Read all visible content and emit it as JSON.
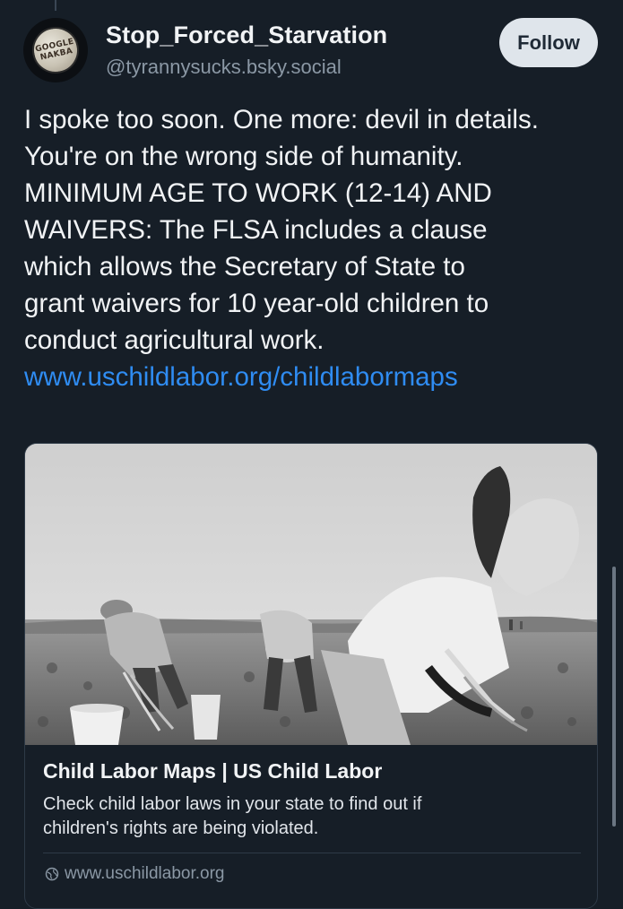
{
  "author": {
    "display_name": "Stop_Forced_Starvation",
    "handle": "@tyrannysucks.bsky.social",
    "avatar_text_line1": "GOOGLE",
    "avatar_text_line2": "NAKBA"
  },
  "actions": {
    "follow_label": "Follow"
  },
  "post": {
    "lines": [
      "I spoke too soon. One more: devil in details.",
      "You're on the wrong side of humanity.",
      "MINIMUM AGE TO WORK (12-14) AND",
      "WAIVERS: The FLSA includes a clause",
      "which allows the Secretary of State to",
      "grant waivers for 10 year-old children to",
      "conduct agricultural work."
    ],
    "link_text": "www.uschildlabor.org/childlabormaps"
  },
  "link_card": {
    "image_icon": "photo-farm-workers-icon",
    "title": "Child Labor Maps | US Child Labor",
    "description_lines": [
      "Check child labor laws in your state to find out if",
      "children's rights are being violated."
    ],
    "domain": "www.uschildlabor.org",
    "domain_icon": "globe-icon"
  },
  "colors": {
    "background": "#161e27",
    "link": "#2f8cf2",
    "muted": "#8b98a5",
    "follow_button_bg": "#dfe5eb"
  }
}
